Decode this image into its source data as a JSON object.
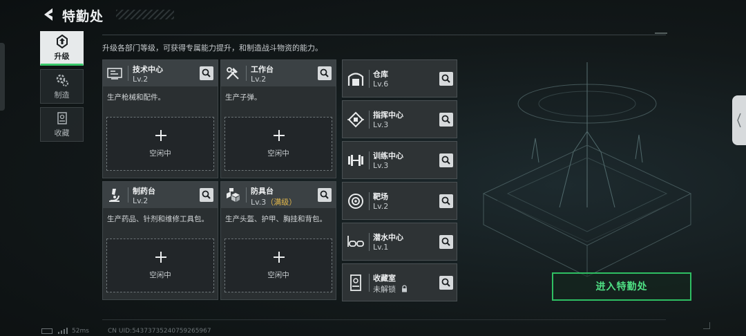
{
  "header": {
    "title": "特勤处"
  },
  "description": "升级各部门等级，可获得专属能力提升，和制造战斗物资的能力。",
  "sidebar": {
    "items": [
      {
        "label": "升级",
        "icon": "upgrade-icon",
        "active": true
      },
      {
        "label": "制造",
        "icon": "gears-icon",
        "active": false
      },
      {
        "label": "收藏",
        "icon": "collection-icon",
        "active": false
      }
    ]
  },
  "cards": [
    {
      "name": "技术中心",
      "level": "Lv.2",
      "max": "",
      "desc": "生产枪械和配件。",
      "icon": "tech-center-icon",
      "slot_plus": "+",
      "slot_label": "空闲中"
    },
    {
      "name": "工作台",
      "level": "Lv.2",
      "max": "",
      "desc": "生产子弹。",
      "icon": "tools-icon",
      "slot_plus": "+",
      "slot_label": "空闲中"
    },
    {
      "name": "制药台",
      "level": "Lv.2",
      "max": "",
      "desc": "生产药品、针剂和维修工具包。",
      "icon": "microscope-icon",
      "slot_plus": "+",
      "slot_label": "空闲中"
    },
    {
      "name": "防具台",
      "level": "Lv.3",
      "max": "（满级）",
      "desc": "生产头盔、护甲、胸挂和背包。",
      "icon": "armor-boxes-icon",
      "slot_plus": "+",
      "slot_label": "空闲中"
    }
  ],
  "facilities": [
    {
      "name": "仓库",
      "level": "Lv.6",
      "icon": "warehouse-icon",
      "locked": false
    },
    {
      "name": "指挥中心",
      "level": "Lv.3",
      "icon": "command-chip-icon",
      "locked": false
    },
    {
      "name": "训练中心",
      "level": "Lv.3",
      "icon": "dumbbell-icon",
      "locked": false
    },
    {
      "name": "靶场",
      "level": "Lv.2",
      "icon": "target-icon",
      "locked": false
    },
    {
      "name": "潜水中心",
      "level": "Lv.1",
      "icon": "diving-goggles-icon",
      "locked": false
    },
    {
      "name": "收藏室",
      "level": "未解锁",
      "icon": "display-case-icon",
      "locked": true
    }
  ],
  "enter_button": "进入特勤处",
  "status": {
    "ping": "52ms",
    "uid": "CN UID:54373735240759265967"
  },
  "colors": {
    "accent_green": "#2fbf63",
    "max_level": "#e3b84b"
  }
}
